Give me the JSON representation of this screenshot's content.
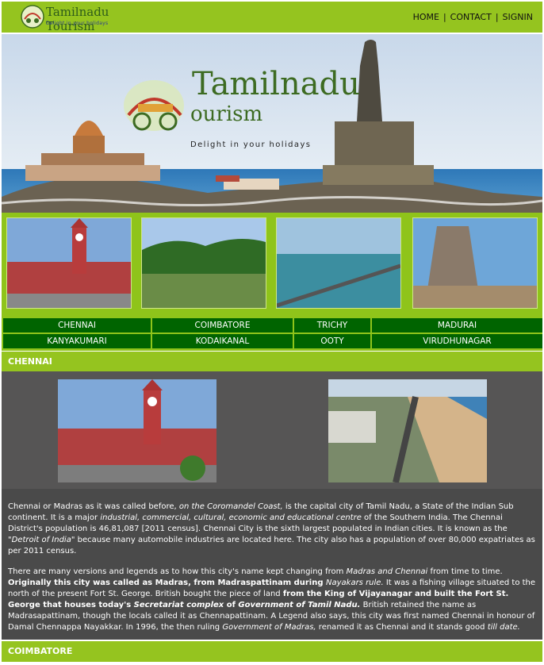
{
  "header": {
    "logo_title": "Tamilnadu Tourism",
    "logo_tagline": "Delight in your holidays",
    "nav": [
      {
        "label": "HOME"
      },
      {
        "label": "CONTACT"
      },
      {
        "label": "SIGNIN"
      }
    ]
  },
  "hero": {
    "logo_line1": "Tamilnadu",
    "logo_line2": "ourism",
    "tagline": "Delight in your holidays"
  },
  "destinations": [
    [
      "CHENNAI",
      "COIMBATORE",
      "TRICHY",
      "MADURAI"
    ],
    [
      "KANYAKUMARI",
      "KODAIKANAL",
      "OOTY",
      "VIRUDHUNAGAR"
    ]
  ],
  "sections": {
    "chennai_title": "CHENNAI",
    "coimbatore_title": "COIMBATORE"
  },
  "content": {
    "p1_a": "Chennai or Madras as it was called before, ",
    "p1_b": "on the Coromandel Coast,",
    "p1_c": " is the capital city of Tamil Nadu, a State of the Indian Sub continent. It is a major ",
    "p1_d": "industrial, commercial, cultural, economic and educational centre",
    "p1_e": " of the Southern India. The Chennai District's population is 46,81,087 [2011 census]. Chennai City is the sixth largest populated in Indian cities. It is known as the ",
    "p1_f": "\"Detroit of India\"",
    "p1_g": " because many automobile industries are located here. The city also has a population of over 80,000 expatriates as per 2011 census.",
    "p2_a": "There are many versions and legends as to how this city's name kept changing from ",
    "p2_b": "Madras and Chennai",
    "p2_c": " from time to time. ",
    "p2_d": "Originally this city was called as Madras, from Madraspattinam during ",
    "p2_e": "Nayakars rule.",
    "p2_f": " It was a fishing village situated to the north of the present Fort St. George. British bought the piece of land ",
    "p2_g": "from the King of Vijayanagar and built the Fort St. George that houses today's ",
    "p2_h": "Secretariat complex",
    "p2_i": " of ",
    "p2_j": "Government of Tamil Nadu.",
    "p2_k": " British retained the name as Madrasapattinam, though the locals called it as Chennapattinam. A Legend also says, this city was first named Chennai in honour of Damal Chennappa Nayakkar. In 1996, the then ruling ",
    "p2_l": "Government of Madras,",
    "p2_m": " renamed it as Chennai and it stands good ",
    "p2_n": "till date."
  },
  "colors": {
    "brand_green": "#95c41f",
    "nav_cell_green": "#006400",
    "content_bg": "#4a4a4a"
  }
}
